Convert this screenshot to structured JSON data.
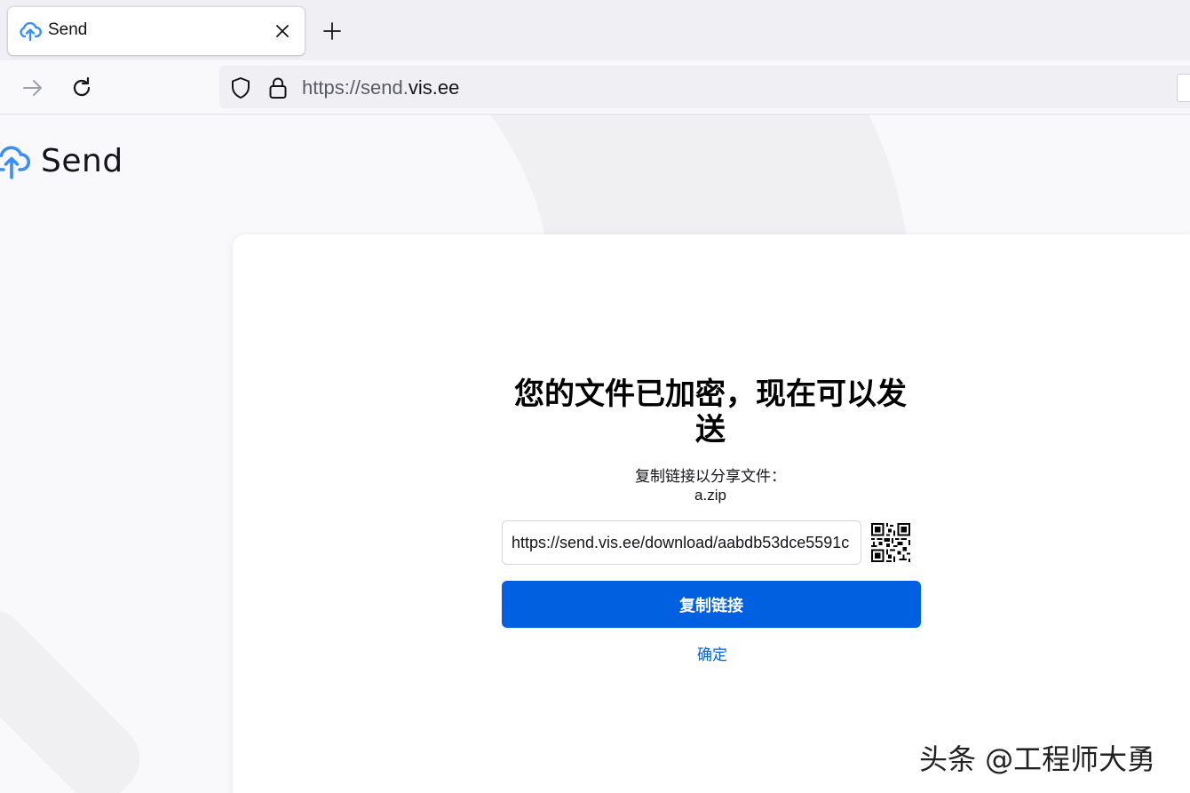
{
  "browser": {
    "tab_title": "Send",
    "url_prefix": "https://send.",
    "url_host": "vis.ee"
  },
  "app": {
    "logo_text": "Send"
  },
  "upload_complete": {
    "heading": "您的文件已加密，现在可以发送",
    "subtext": "复制链接以分享文件：",
    "filename": "a.zip",
    "share_link": "https://send.vis.ee/download/aabdb53dce5591c",
    "copy_button_label": "复制链接",
    "ok_link_label": "确定"
  },
  "watermark": "头条 @工程师大勇",
  "colors": {
    "accent": "#0060df",
    "logo_blue": "#3a8ff7"
  },
  "icons": {
    "tab": "cloud-upload-icon",
    "close": "close-icon",
    "new_tab": "plus-icon",
    "forward": "arrow-right-icon",
    "reload": "reload-icon",
    "shield": "shield-icon",
    "lock": "lock-icon",
    "qr": "qr-code-icon"
  }
}
